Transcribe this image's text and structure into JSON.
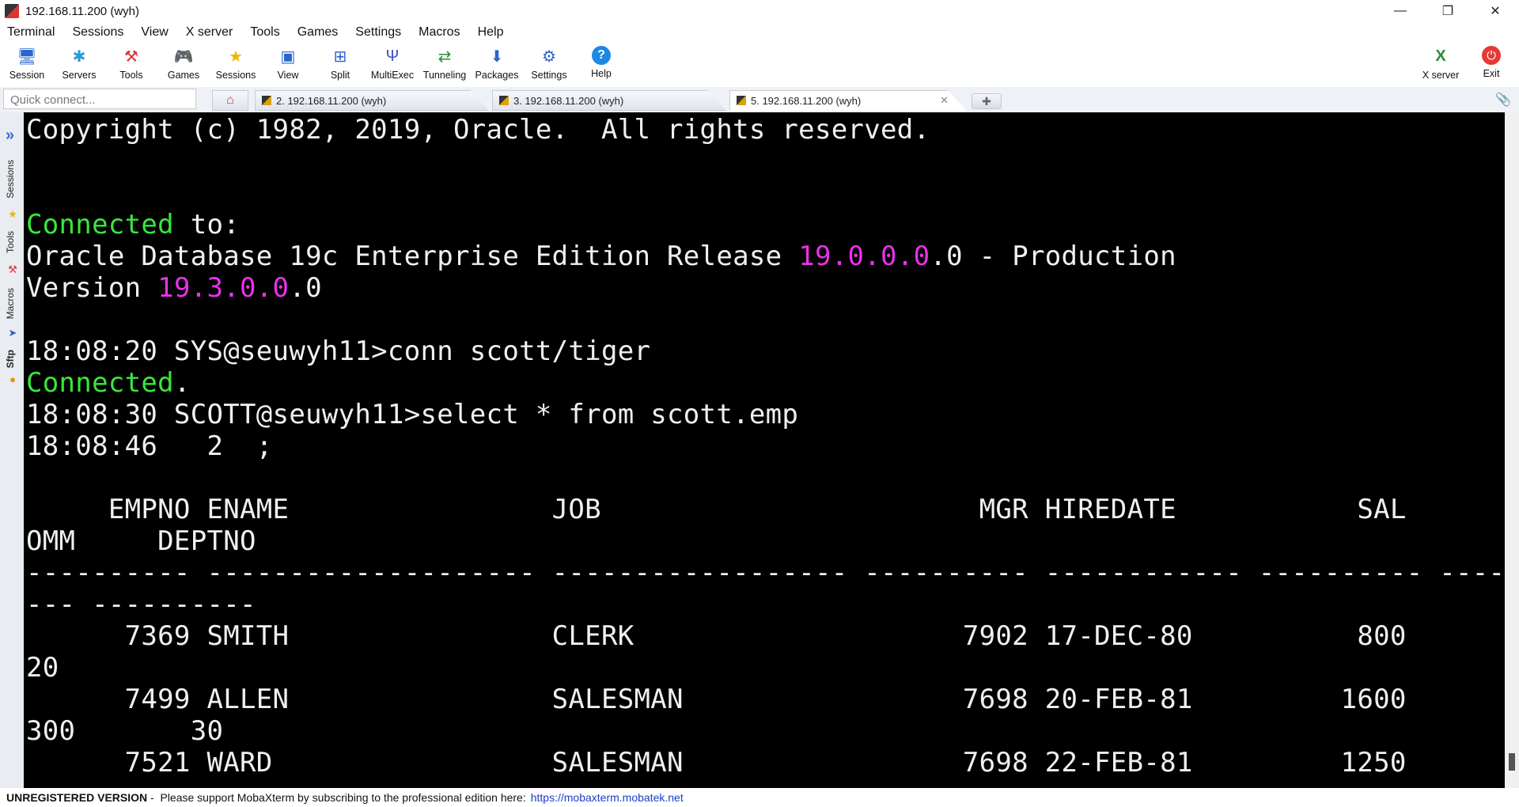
{
  "window": {
    "title": "192.168.11.200 (wyh)",
    "controls": {
      "minimize": "—",
      "restore": "❐",
      "close": "✕"
    }
  },
  "menu": [
    "Terminal",
    "Sessions",
    "View",
    "X server",
    "Tools",
    "Games",
    "Settings",
    "Macros",
    "Help"
  ],
  "toolbar": {
    "items": [
      {
        "label": "Session",
        "icon": "session-icon"
      },
      {
        "label": "Servers",
        "icon": "servers-icon"
      },
      {
        "label": "Tools",
        "icon": "tools-icon"
      },
      {
        "label": "Games",
        "icon": "games-icon"
      },
      {
        "label": "Sessions",
        "icon": "star-icon"
      },
      {
        "label": "View",
        "icon": "view-icon"
      },
      {
        "label": "Split",
        "icon": "split-icon"
      },
      {
        "label": "MultiExec",
        "icon": "multiexec-icon"
      },
      {
        "label": "Tunneling",
        "icon": "tunneling-icon"
      },
      {
        "label": "Packages",
        "icon": "packages-icon"
      },
      {
        "label": "Settings",
        "icon": "settings-icon"
      },
      {
        "label": "Help",
        "icon": "help-icon"
      }
    ],
    "right_items": [
      {
        "label": "X server",
        "icon": "xserver-icon"
      },
      {
        "label": "Exit",
        "icon": "power-icon"
      }
    ]
  },
  "quick_connect": {
    "placeholder": "Quick connect..."
  },
  "tabs": [
    {
      "label": "2. 192.168.11.200 (wyh)",
      "active": false
    },
    {
      "label": "3. 192.168.11.200 (wyh)",
      "active": false
    },
    {
      "label": "5. 192.168.11.200 (wyh)",
      "active": true
    }
  ],
  "sidebar": {
    "labels": [
      "Sessions",
      "Tools",
      "Macros",
      "Sftp"
    ]
  },
  "terminal": {
    "copyright": "Copyright (c) 1982, 2019, Oracle.  All rights reserved.",
    "connected_word": "Connected",
    "connected_rest": " to:",
    "db_prefix": "Oracle Database 19c Enterprise Edition Release ",
    "db_version_hl": "19.0.0.0",
    "db_suffix": ".0 - Production",
    "version_prefix": "Version ",
    "version_hl": "19.3.0.0",
    "version_suffix": ".0",
    "line_conn": "18:08:20 SYS@seuwyh11>conn scott/tiger",
    "connected2_word": "Connected",
    "connected2_rest": ".",
    "line_select": "18:08:30 SCOTT@seuwyh11>select * from scott.emp",
    "line_cont": "18:08:46   2  ;",
    "header1": "     EMPNO ENAME                JOB                       MGR HIREDATE           SAL          C",
    "header2": "OMM     DEPTNO",
    "dashes1": "---------- -------------------- ------------------ ---------- ------------ ---------- ----------",
    "dashes2": "--- ----------",
    "rows": [
      {
        "line1": "      7369 SMITH                CLERK                    7902 17-DEC-80          800",
        "line2": "20"
      },
      {
        "line1": "      7499 ALLEN                SALESMAN                 7698 20-FEB-81         1600",
        "line2": "300       30"
      },
      {
        "line1": "      7521 WARD                 SALESMAN                 7698 22-FEB-81         1250",
        "line2": ""
      }
    ]
  },
  "status": {
    "strong": "UNREGISTERED VERSION",
    "text": " -  Please support MobaXterm by subscribing to the professional edition here:",
    "link": "https://mobaxterm.mobatek.net"
  },
  "colors": {
    "prompt_green": "#39e63e",
    "version_magenta": "#e832e8",
    "terminal_bg": "#000000"
  }
}
